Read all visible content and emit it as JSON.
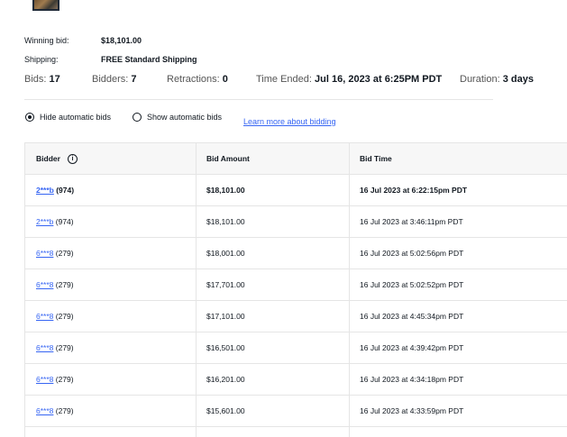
{
  "summary": {
    "winning_bid_label": "Winning bid:",
    "winning_bid_value": "$18,101.00",
    "shipping_label": "Shipping:",
    "shipping_value": "FREE Standard Shipping"
  },
  "stats": {
    "bids_label": "Bids:",
    "bids_value": "17",
    "bidders_label": "Bidders:",
    "bidders_value": "7",
    "retractions_label": "Retractions:",
    "retractions_value": "0",
    "time_ended_label": "Time Ended:",
    "time_ended_value": "Jul 16, 2023 at 6:25PM PDT",
    "duration_label": "Duration:",
    "duration_value": "3 days"
  },
  "options": {
    "hide_label": "Hide automatic bids",
    "hide_selected": true,
    "show_label": "Show automatic bids",
    "learn_more": "Learn more about bidding"
  },
  "table": {
    "headers": [
      "Bidder",
      "Bid Amount",
      "Bid Time"
    ],
    "info_glyph": "i",
    "rows": [
      {
        "bidder": "2***b",
        "rating": "(974)",
        "amount": "$18,101.00",
        "time": "16 Jul 2023 at 6:22:15pm PDT",
        "winning": true
      },
      {
        "bidder": "2***b",
        "rating": "(974)",
        "amount": "$18,101.00",
        "time": "16 Jul 2023 at 3:46:11pm PDT",
        "winning": false
      },
      {
        "bidder": "6***8",
        "rating": "(279)",
        "amount": "$18,001.00",
        "time": "16 Jul 2023 at 5:02:56pm PDT",
        "winning": false
      },
      {
        "bidder": "6***8",
        "rating": "(279)",
        "amount": "$17,701.00",
        "time": "16 Jul 2023 at 5:02:52pm PDT",
        "winning": false
      },
      {
        "bidder": "6***8",
        "rating": "(279)",
        "amount": "$17,101.00",
        "time": "16 Jul 2023 at 4:45:34pm PDT",
        "winning": false
      },
      {
        "bidder": "6***8",
        "rating": "(279)",
        "amount": "$16,501.00",
        "time": "16 Jul 2023 at 4:39:42pm PDT",
        "winning": false
      },
      {
        "bidder": "6***8",
        "rating": "(279)",
        "amount": "$16,201.00",
        "time": "16 Jul 2023 at 4:34:18pm PDT",
        "winning": false
      },
      {
        "bidder": "6***8",
        "rating": "(279)",
        "amount": "$15,601.00",
        "time": "16 Jul 2023 at 4:33:59pm PDT",
        "winning": false
      }
    ]
  }
}
